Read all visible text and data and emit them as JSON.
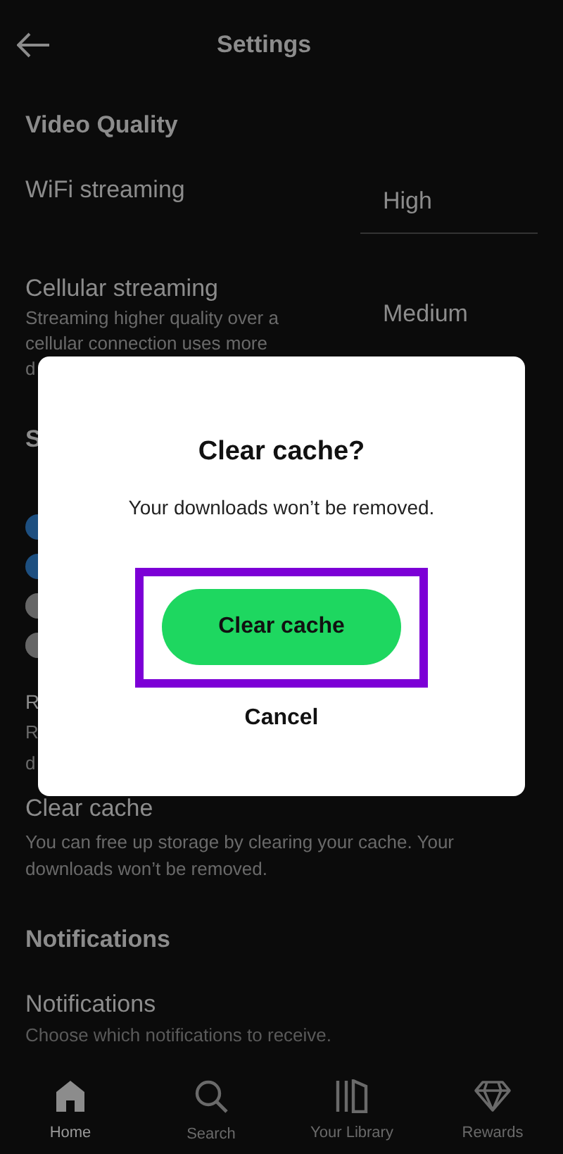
{
  "header": {
    "title": "Settings"
  },
  "video_quality": {
    "heading": "Video Quality",
    "wifi": {
      "label": "WiFi streaming",
      "value": "High"
    },
    "cellular": {
      "label": "Cellular streaming",
      "description": "Streaming higher quality over a cellular connection uses more",
      "description_cut": "d",
      "value": "Medium"
    }
  },
  "storage_heading_cut": "S",
  "toggles": [
    {
      "on": true
    },
    {
      "on": true
    },
    {
      "on": false
    },
    {
      "on": false
    }
  ],
  "cut_rows": [
    "R",
    "R",
    "d"
  ],
  "clear_cache": {
    "label": "Clear cache",
    "description": "You can free up storage by clearing your cache. Your downloads won’t be removed."
  },
  "notifications": {
    "heading": "Notifications",
    "label": "Notifications",
    "description": "Choose which notifications to receive."
  },
  "dialog": {
    "title": "Clear cache?",
    "message": "Your downloads won’t be removed.",
    "confirm": "Clear cache",
    "cancel": "Cancel",
    "confirm_highlighted": true
  },
  "nav": [
    {
      "kind": "home",
      "label": "Home",
      "selected": true
    },
    {
      "kind": "search",
      "label": "Search",
      "selected": false
    },
    {
      "kind": "library",
      "label": "Your Library",
      "selected": false
    },
    {
      "kind": "rewards",
      "label": "Rewards",
      "selected": false
    }
  ]
}
